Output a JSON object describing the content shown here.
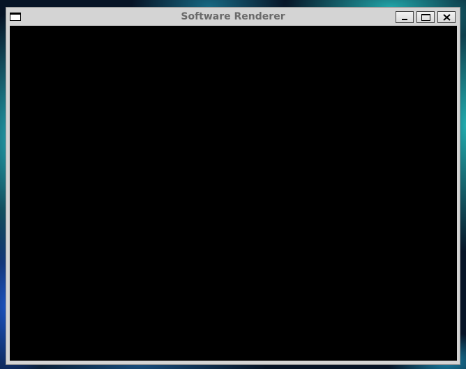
{
  "window": {
    "title": "Software Renderer",
    "menu_icon": "window-menu-icon",
    "controls": {
      "minimize_icon": "minimize-icon",
      "maximize_icon": "maximize-icon",
      "close_icon": "close-icon"
    },
    "canvas_color": "#000000",
    "frame_color": "#d4d4d4",
    "title_color": "#6a6a6a"
  }
}
